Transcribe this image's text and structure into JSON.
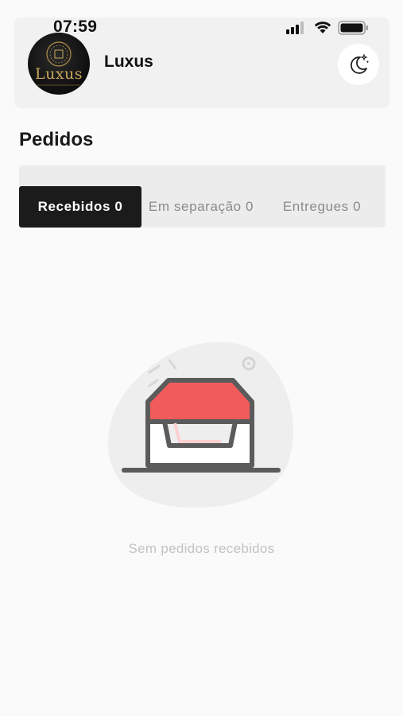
{
  "status_bar": {
    "time": "07:59"
  },
  "header": {
    "logo_text": "Luxus",
    "brand_name": "Luxus"
  },
  "page": {
    "title": "Pedidos"
  },
  "tabs": [
    {
      "label": "Recebidos 0",
      "active": true
    },
    {
      "label": "Em separação 0",
      "active": false
    },
    {
      "label": "Entregues 0",
      "active": false
    }
  ],
  "empty_state": {
    "message": "Sem pedidos recebidos",
    "icon": "empty-inbox-icon"
  },
  "colors": {
    "active_tab": "#1b1b1b",
    "accent_red": "#f25b5b",
    "logo_gold": "#c9a75c"
  }
}
